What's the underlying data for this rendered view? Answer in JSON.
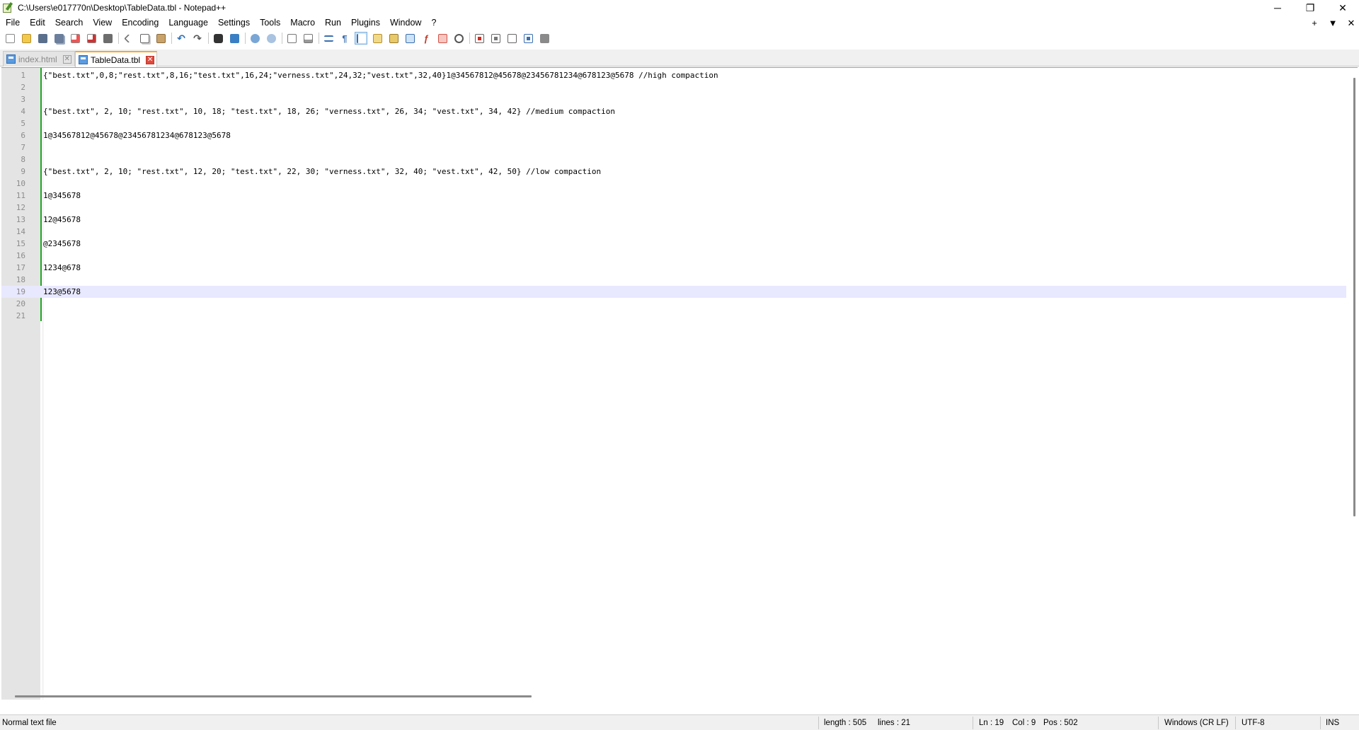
{
  "window": {
    "title": "C:\\Users\\e017770n\\Desktop\\TableData.tbl - Notepad++",
    "controls": {
      "minimize": "─",
      "maximize": "❐",
      "close": "✕"
    }
  },
  "menu": {
    "items": [
      "File",
      "Edit",
      "Search",
      "View",
      "Encoding",
      "Language",
      "Settings",
      "Tools",
      "Macro",
      "Run",
      "Plugins",
      "Window",
      "?"
    ],
    "right": {
      "add": "+",
      "dropdown": "▼",
      "close": "✕"
    }
  },
  "toolbar": {
    "icons": [
      "new-file-icon",
      "open-file-icon",
      "save-icon",
      "save-all-icon",
      "close-icon",
      "close-all-icon",
      "print-icon",
      "cut-icon",
      "copy-icon",
      "paste-icon",
      "undo-icon",
      "redo-icon",
      "find-icon",
      "replace-icon",
      "zoom-in-icon",
      "zoom-out-icon",
      "sync-vertical-icon",
      "sync-horizontal-icon",
      "word-wrap-icon",
      "show-all-chars-icon",
      "indent-guide-icon",
      "lang-udl-icon",
      "doc-map-icon",
      "doc-list-icon",
      "function-list-icon",
      "folder-workspace-icon",
      "monitoring-icon",
      "record-macro-icon",
      "stop-macro-icon",
      "play-macro-icon",
      "run-macro-multiple-icon",
      "save-macro-icon"
    ]
  },
  "tabs": [
    {
      "label": "index.html",
      "active": false
    },
    {
      "label": "TableData.tbl",
      "active": true
    }
  ],
  "editor": {
    "current_line": 19,
    "lines": [
      "{\"best.txt\",0,8;\"rest.txt\",8,16;\"test.txt\",16,24;\"verness.txt\",24,32;\"vest.txt\",32,40}1@34567812@45678@23456781234@678123@5678 //high compaction",
      "",
      "",
      "{\"best.txt\", 2, 10; \"rest.txt\", 10, 18; \"test.txt\", 18, 26; \"verness.txt\", 26, 34; \"vest.txt\", 34, 42} //medium compaction",
      "",
      "1@34567812@45678@23456781234@678123@5678",
      "",
      "",
      "{\"best.txt\", 2, 10; \"rest.txt\", 12, 20; \"test.txt\", 22, 30; \"verness.txt\", 32, 40; \"vest.txt\", 42, 50} //low compaction",
      "",
      "1@345678",
      "",
      "12@45678",
      "",
      "@2345678",
      "",
      "1234@678",
      "",
      "123@5678",
      "",
      ""
    ]
  },
  "status": {
    "file_type": "Normal text file",
    "length": "length : 505",
    "lines": "lines : 21",
    "ln": "Ln : 19",
    "col": "Col : 9",
    "pos": "Pos : 502",
    "eol": "Windows (CR LF)",
    "encoding": "UTF-8",
    "mode": "INS"
  }
}
